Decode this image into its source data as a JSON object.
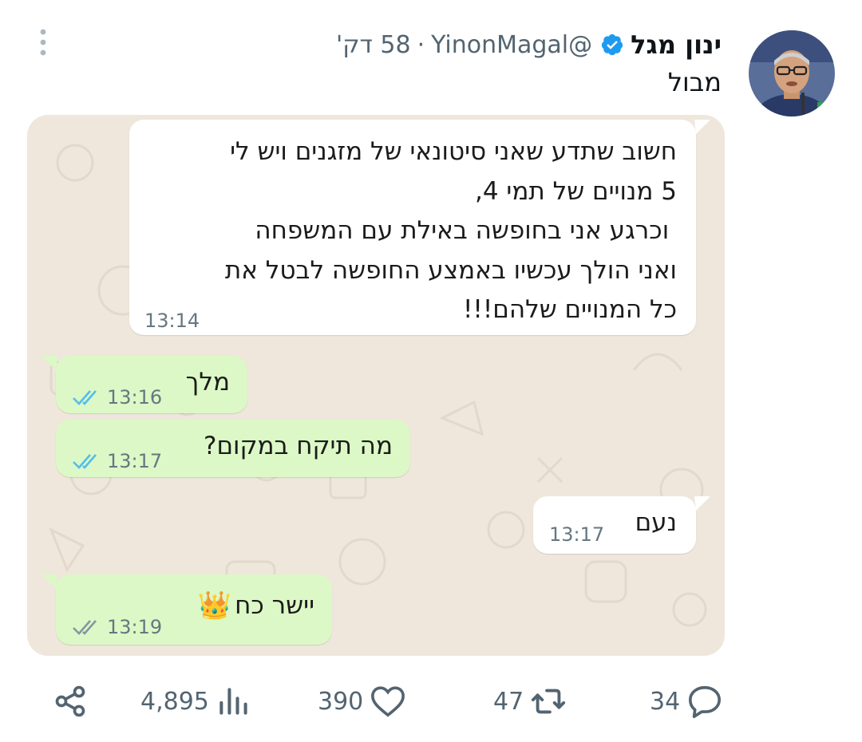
{
  "tweet": {
    "author_name": "ינון מגל",
    "handle": "@YinonMagal",
    "separator": "·",
    "time_ago": "58 דק'",
    "text": "מבול"
  },
  "chat": {
    "messages": [
      {
        "direction": "incoming",
        "lines": [
          "חשוב שתדע שאני סיטונאי של מזגנים ויש לי",
          "5 מנויים של תמי 4,",
          " וכרגע אני בחופשה באילת עם המשפחה",
          "ואני הולך עכשיו באמצע החופשה לבטל את",
          "כל המנויים שלהם!!!"
        ],
        "time": "13:14"
      },
      {
        "direction": "outgoing",
        "text": "מלך",
        "time": "13:16",
        "ticks": "read"
      },
      {
        "direction": "outgoing",
        "text": "מה תיקח במקום?",
        "time": "13:17",
        "ticks": "read"
      },
      {
        "direction": "incoming",
        "text": "נעם",
        "time": "13:17"
      },
      {
        "direction": "outgoing",
        "text": "יישר כח",
        "emoji": "👑",
        "time": "13:19",
        "ticks": "delivered"
      }
    ],
    "colors": {
      "background": "#efe7dc",
      "incoming": "#ffffff",
      "outgoing": "#dcf8c6",
      "read_ticks": "#53bdeb",
      "delivered_ticks": "#8696a0"
    }
  },
  "actions": {
    "replies": "34",
    "retweets": "47",
    "likes": "390",
    "views": "4,895"
  },
  "icons": [
    "more-vertical-icon",
    "verified-badge-icon",
    "reply-icon",
    "retweet-icon",
    "like-icon",
    "views-icon",
    "share-icon"
  ],
  "accent": "#1d9bf0"
}
